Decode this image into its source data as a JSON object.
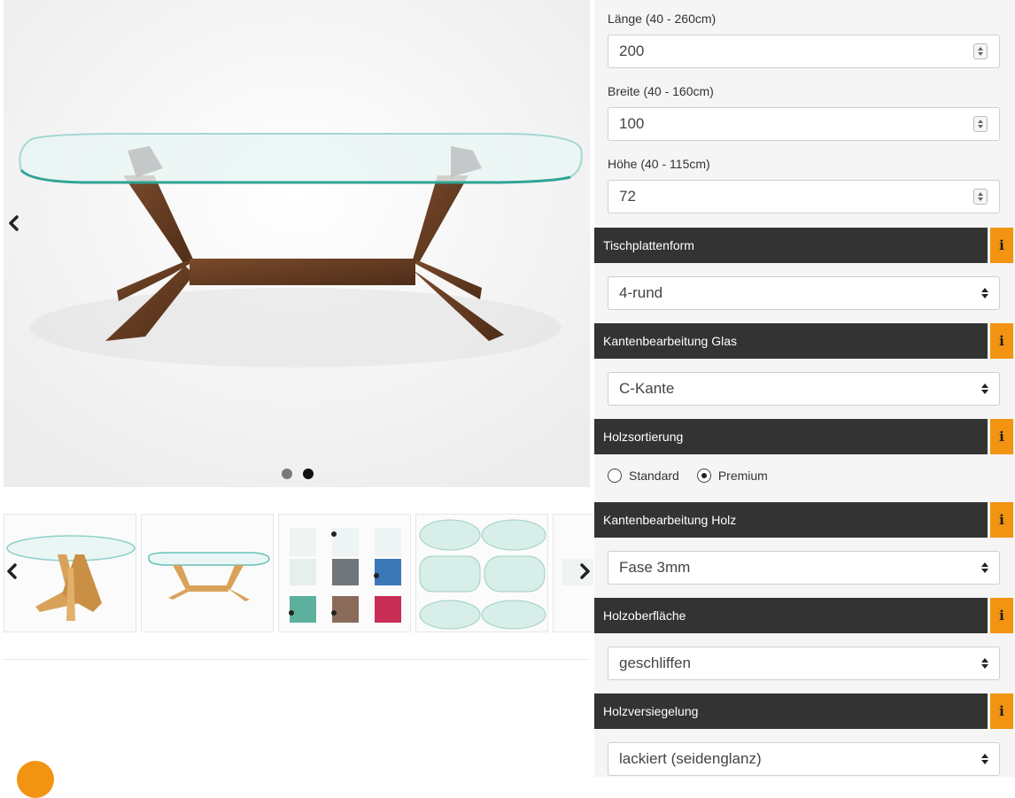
{
  "gallery": {
    "icons": {
      "prev": "chevron-left-icon",
      "next": "chevron-right-icon"
    },
    "dots": [
      {
        "active": false
      },
      {
        "active": true
      }
    ],
    "thumbnails": [
      {
        "name": "oak-star-base-oval-table"
      },
      {
        "name": "oak-table-side-view"
      },
      {
        "name": "glass-color-samples"
      },
      {
        "name": "glass-shape-samples"
      },
      {
        "name": "partial-thumbnail"
      }
    ]
  },
  "dimensions": {
    "length": {
      "label": "Länge (40 - 260cm)",
      "value": "200"
    },
    "width": {
      "label": "Breite (40 - 160cm)",
      "value": "100"
    },
    "height": {
      "label": "Höhe (40 - 115cm)",
      "value": "72"
    }
  },
  "sections": {
    "tischplattenform": {
      "title": "Tischplattenform",
      "info": "i",
      "selected": "4-rund"
    },
    "kanten_glas": {
      "title": "Kantenbearbeitung Glas",
      "info": "i",
      "selected": "C-Kante"
    },
    "holzsortierung": {
      "title": "Holzsortierung",
      "info": "i",
      "options": [
        {
          "label": "Standard",
          "checked": false
        },
        {
          "label": "Premium",
          "checked": true
        }
      ]
    },
    "kanten_holz": {
      "title": "Kantenbearbeitung Holz",
      "info": "i",
      "selected": "Fase 3mm"
    },
    "holzoberflaeche": {
      "title": "Holzoberfläche",
      "info": "i",
      "selected": "geschliffen"
    },
    "holzversiegelung": {
      "title": "Holzversiegelung",
      "info": "i",
      "selected": "lackiert (seidenglanz)"
    }
  },
  "colors": {
    "accent": "#f29312",
    "bar": "#333333",
    "walnut": "#5e3a22",
    "oak": "#d9a25a",
    "glass": "#bfe3df"
  }
}
